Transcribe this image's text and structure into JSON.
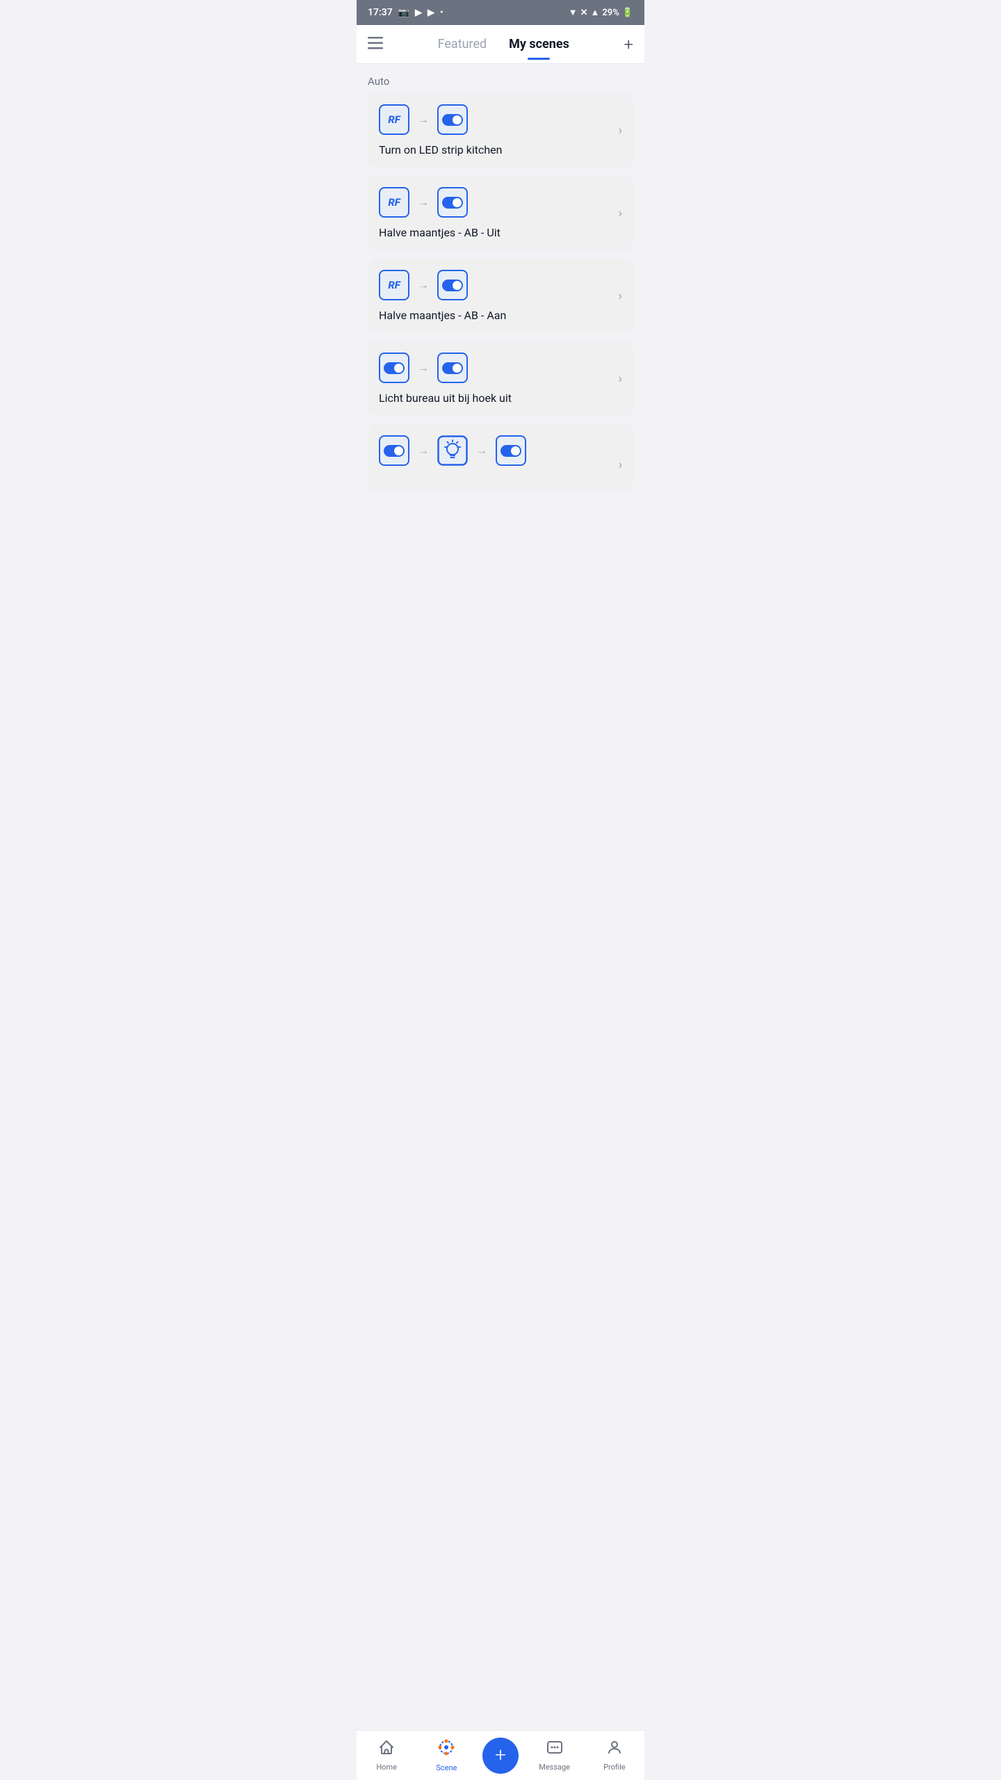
{
  "statusBar": {
    "time": "17:37",
    "battery": "29%"
  },
  "header": {
    "tabFeatured": "Featured",
    "tabMyScenes": "My scenes",
    "addBtn": "+"
  },
  "sectionLabel": "Auto",
  "scenes": [
    {
      "id": 1,
      "title": "Turn on LED strip kitchen",
      "triggerType": "rf",
      "actionType": "toggle"
    },
    {
      "id": 2,
      "title": "Halve maantjes - AB - Uit",
      "triggerType": "rf",
      "actionType": "toggle"
    },
    {
      "id": 3,
      "title": "Halve maantjes - AB - Aan",
      "triggerType": "rf",
      "actionType": "toggle"
    },
    {
      "id": 4,
      "title": "Licht bureau uit bij hoek uit",
      "triggerType": "toggle",
      "actionType": "toggle"
    },
    {
      "id": 5,
      "title": "",
      "triggerType": "toggle",
      "actionType": "bulb_toggle",
      "partial": true
    }
  ],
  "bottomNav": {
    "items": [
      {
        "id": "home",
        "label": "Home",
        "icon": "home",
        "active": false
      },
      {
        "id": "scene",
        "label": "Scene",
        "icon": "scene",
        "active": true
      },
      {
        "id": "add",
        "label": "",
        "icon": "plus",
        "active": false,
        "isAdd": true
      },
      {
        "id": "message",
        "label": "Message",
        "icon": "message",
        "active": false
      },
      {
        "id": "profile",
        "label": "Profile",
        "icon": "profile",
        "active": false
      }
    ]
  }
}
